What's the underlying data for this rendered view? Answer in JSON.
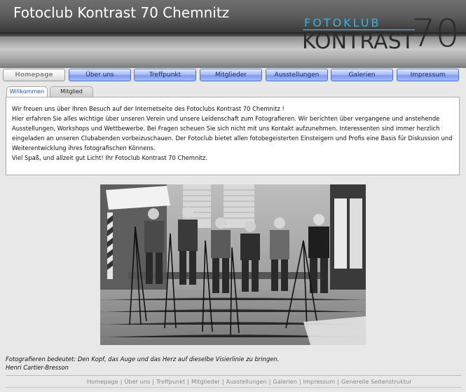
{
  "header": {
    "site_title": "Fotoclub Kontrast 70 Chemnitz",
    "logo_top": "FOTOKLUB",
    "logo_main": "KONTRAST",
    "logo_number": "70"
  },
  "nav": {
    "items": [
      "Homepage",
      "Über uns",
      "Treffpunkt",
      "Mitglieder",
      "Ausstellungen",
      "Galerien",
      "Impressum"
    ]
  },
  "tabs": [
    "Willkommen",
    "Mitglied werden"
  ],
  "content": {
    "lines": [
      "Wir freuen uns über Ihren Besuch auf der Internetseite des Fotoclubs Kontrast 70 Chemnitz !",
      "Hier erfahren Sie alles wichtige über unseren Verein und unsere Leidenschaft zum Fotografieren. Wir berichten über vergangene und anstehende",
      "Ausstellungen, Workshops und Wettbewerbe. Bei Fragen scheuen Sie sich nicht mit uns Kontakt aufzunehmen. Interessenten sind immer herzlich",
      "eingeladen an unseren Clubabenden vorbeizuschauen. Der Fotoclub bietet allen fotobegeisterten Einsteigern und Profis eine Basis für Diskussion und",
      "Weiterentwicklung ihres fotografischen Könnens.",
      "Viel Spaß, und allzeit gut Licht! Ihr Fotoclub Kontrast 70 Chemnitz."
    ]
  },
  "quote": {
    "text": "Fotografieren bedeutet: Den Kopf, das Auge und das Herz auf dieselbe Visierlinie zu bringen.",
    "author": "Henri Cartier-Bresson"
  },
  "footer": {
    "links": [
      "Homepage",
      "Über uns",
      "Treffpunkt",
      "Mitglieder",
      "Ausstellungen",
      "Galerien",
      "Impressum",
      "Generelle Seitenstruktur"
    ],
    "separator": "|"
  },
  "colors": {
    "nav_blue": "#8ea8f3",
    "active_tab_text": "#2255bb",
    "logo_accent": "#3fb0d8"
  }
}
